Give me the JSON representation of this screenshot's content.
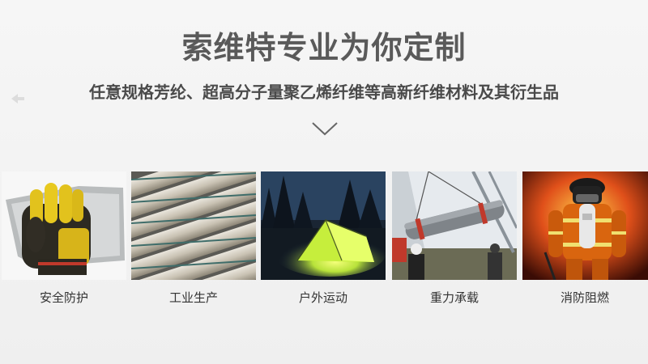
{
  "header": {
    "title": "索维特专业为你定制",
    "subtitle": "任意规格芳纶、超高分子量聚乙烯纤维等高新纤维材料及其衍生品"
  },
  "icons": {
    "scroll": "chevron-down-icon"
  },
  "categories": [
    {
      "label": "安全防护",
      "image": "cut-resistant-glove-image"
    },
    {
      "label": "工业生产",
      "image": "fiber-rope-bundle-image"
    },
    {
      "label": "户外运动",
      "image": "glowing-tent-image"
    },
    {
      "label": "重力承载",
      "image": "crane-lifting-image"
    },
    {
      "label": "消防阻燃",
      "image": "firefighter-image"
    }
  ]
}
